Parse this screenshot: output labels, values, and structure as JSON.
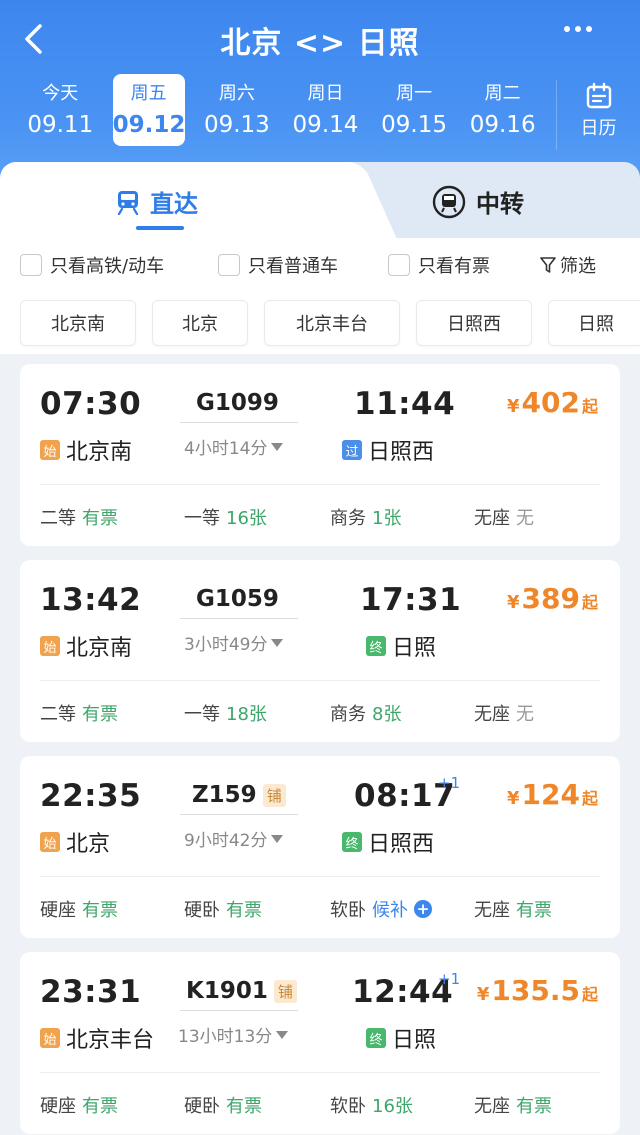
{
  "header": {
    "title": "北京 <> 日照",
    "dates": [
      {
        "weekday": "今天",
        "date": "09.11"
      },
      {
        "weekday": "周五",
        "date": "09.12"
      },
      {
        "weekday": "周六",
        "date": "09.13"
      },
      {
        "weekday": "周日",
        "date": "09.14"
      },
      {
        "weekday": "周一",
        "date": "09.15"
      },
      {
        "weekday": "周二",
        "date": "09.16"
      }
    ],
    "calendar_label": "日历"
  },
  "tabs": {
    "direct": "直达",
    "transfer": "中转"
  },
  "filters": {
    "high_speed": "只看高铁/动车",
    "regular": "只看普通车",
    "available": "只看有票",
    "filter": "筛选"
  },
  "stations": [
    "北京南",
    "北京",
    "北京丰台",
    "日照西",
    "日照"
  ],
  "trains": [
    {
      "dep_time": "07:30",
      "arr_time": "11:44",
      "arr_plus": "",
      "train_no": "G1099",
      "sleeper": "",
      "duration": "4小时14分",
      "dep_tag": "始",
      "dep_station": "北京南",
      "arr_tag": "过",
      "arr_station": "日照西",
      "price_symbol": "¥",
      "price": "402",
      "price_suffix": "起",
      "seats": [
        {
          "name": "二等",
          "status": "有票"
        },
        {
          "name": "一等",
          "status": "16张"
        },
        {
          "name": "商务",
          "status": "1张"
        },
        {
          "name": "无座",
          "status": "无"
        }
      ]
    },
    {
      "dep_time": "13:42",
      "arr_time": "17:31",
      "arr_plus": "",
      "train_no": "G1059",
      "sleeper": "",
      "duration": "3小时49分",
      "dep_tag": "始",
      "dep_station": "北京南",
      "arr_tag": "终",
      "arr_station": "日照",
      "price_symbol": "¥",
      "price": "389",
      "price_suffix": "起",
      "seats": [
        {
          "name": "二等",
          "status": "有票"
        },
        {
          "name": "一等",
          "status": "18张"
        },
        {
          "name": "商务",
          "status": "8张"
        },
        {
          "name": "无座",
          "status": "无"
        }
      ]
    },
    {
      "dep_time": "22:35",
      "arr_time": "08:17",
      "arr_plus": "+1",
      "train_no": "Z159",
      "sleeper": "铺",
      "duration": "9小时42分",
      "dep_tag": "始",
      "dep_station": "北京",
      "arr_tag": "终",
      "arr_station": "日照西",
      "price_symbol": "¥",
      "price": "124",
      "price_suffix": "起",
      "seats": [
        {
          "name": "硬座",
          "status": "有票"
        },
        {
          "name": "硬卧",
          "status": "有票"
        },
        {
          "name": "软卧",
          "status": "候补"
        },
        {
          "name": "无座",
          "status": "有票"
        }
      ]
    },
    {
      "dep_time": "23:31",
      "arr_time": "12:44",
      "arr_plus": "+1",
      "train_no": "K1901",
      "sleeper": "铺",
      "duration": "13小时13分",
      "dep_tag": "始",
      "dep_station": "北京丰台",
      "arr_tag": "终",
      "arr_station": "日照",
      "price_symbol": "¥",
      "price": "135.5",
      "price_suffix": "起",
      "seats": [
        {
          "name": "硬座",
          "status": "有票"
        },
        {
          "name": "硬卧",
          "status": "有票"
        },
        {
          "name": "软卧",
          "status": "16张"
        },
        {
          "name": "无座",
          "status": "有票"
        }
      ]
    }
  ],
  "colors": {
    "accent": "#3d86ef",
    "price": "#f0862a",
    "available": "#3ea66a"
  }
}
